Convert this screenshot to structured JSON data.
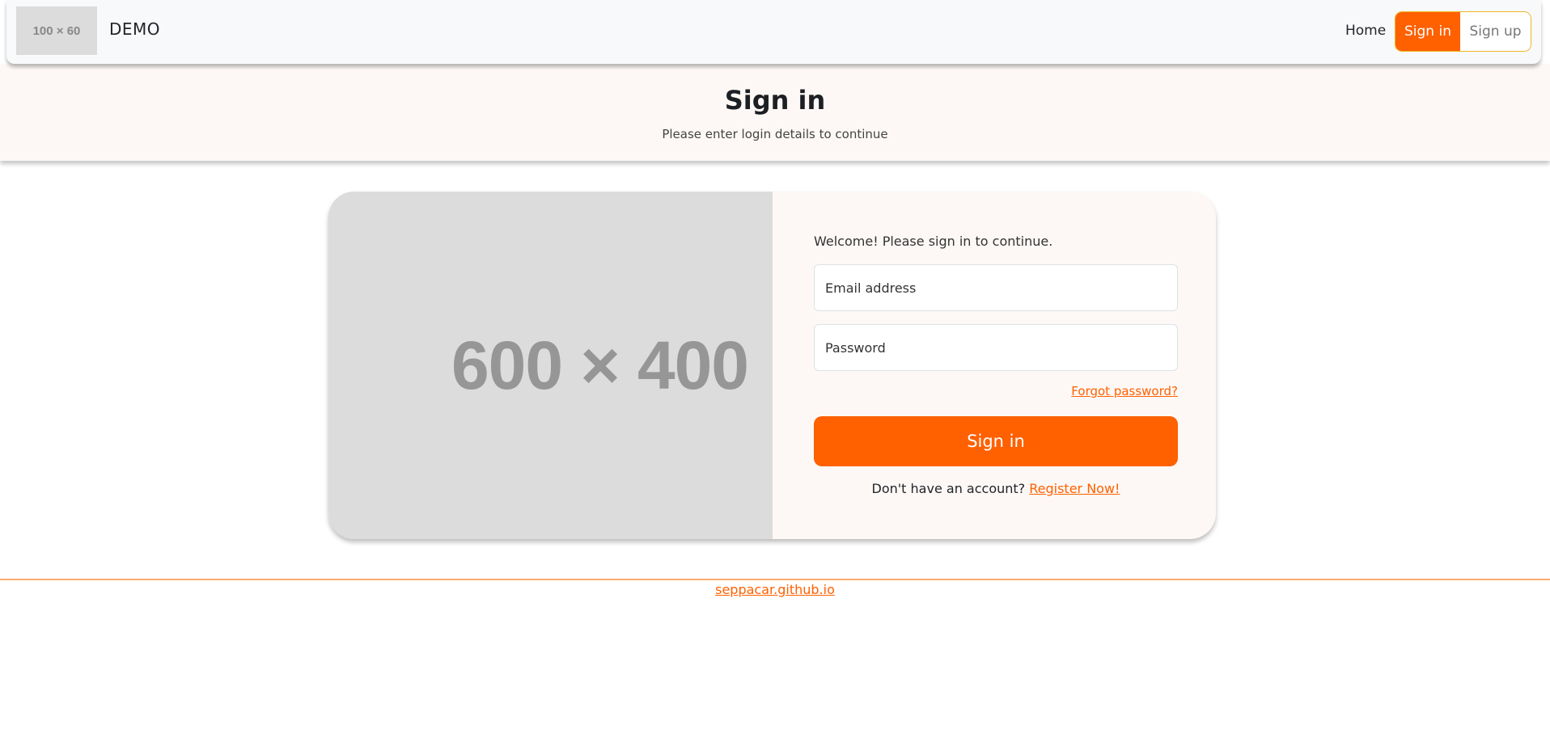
{
  "header": {
    "logo_text": "100 × 60",
    "brand": "DEMO",
    "nav_home": "Home",
    "sign_in": "Sign in",
    "sign_up": "Sign up"
  },
  "title_band": {
    "title": "Sign in",
    "subtitle": "Please enter login details to continue"
  },
  "card": {
    "image_placeholder": "600 × 400",
    "welcome": "Welcome! Please sign in to continue.",
    "email_placeholder": "Email address",
    "password_placeholder": "Password",
    "forgot_password": "Forgot password?",
    "submit": "Sign in",
    "register_prompt": "Don't have an account?",
    "register_link": "Register Now!"
  },
  "footer": {
    "link": "seppacar.github.io"
  },
  "colors": {
    "accent": "#ff6000",
    "navbar_bg": "#f8f9fa",
    "band_bg": "#fdf8f6",
    "placeholder_bg": "#dcdcdc",
    "signup_border": "#f0b429"
  }
}
